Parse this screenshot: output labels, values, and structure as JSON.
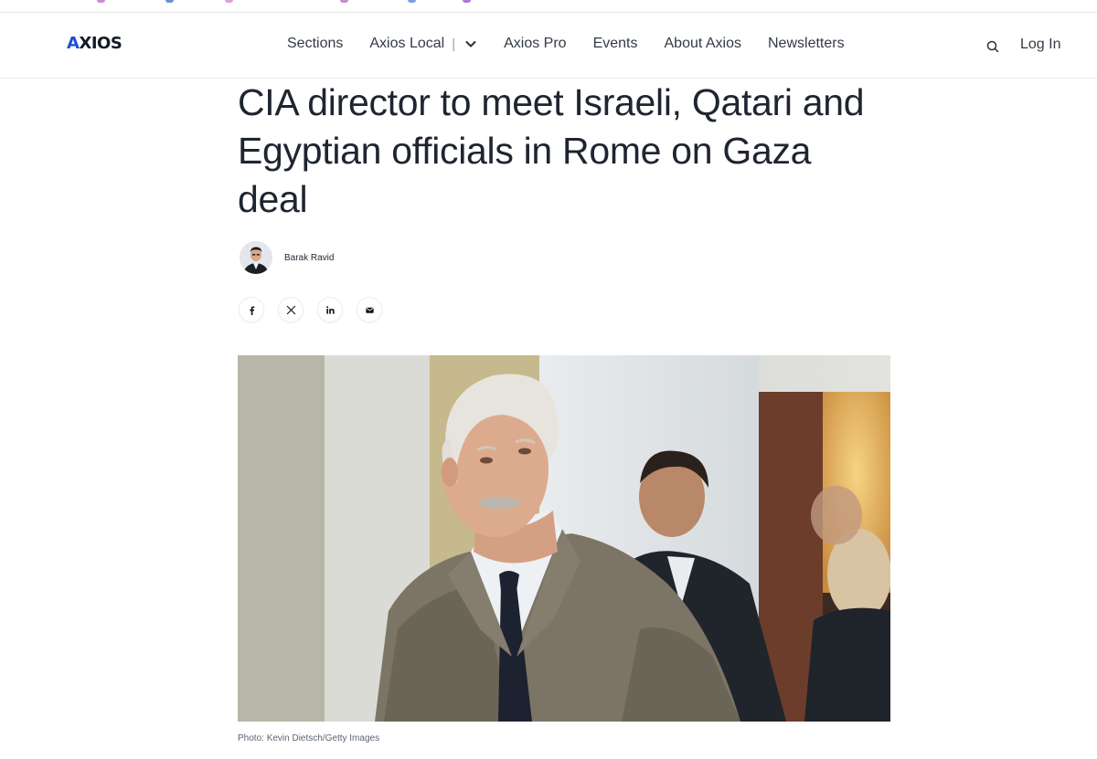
{
  "browser_bar": {
    "bookmark_dot_colors": [
      "#c98bd0",
      "#6c8fd6",
      "#d9a3d6",
      "#7c9ee0",
      "#a77ad8"
    ]
  },
  "header": {
    "logo": {
      "first": "A",
      "rest": "XIOS"
    },
    "nav": {
      "sections": "Sections",
      "local": "Axios Local",
      "local_separator": "|",
      "pro": "Axios Pro",
      "events": "Events",
      "about": "About Axios",
      "newsletters": "Newsletters"
    },
    "login": "Log In",
    "icons": {
      "search": "search-icon",
      "dropdown": "chevron-down-icon"
    }
  },
  "article": {
    "headline": "CIA director to meet Israeli, Qatari and Egyptian officials in Rome on Gaza deal",
    "author": "Barak Ravid",
    "share_icons": [
      "facebook-icon",
      "x-icon",
      "linkedin-icon",
      "email-icon"
    ],
    "photo_caption": "Photo: Kevin Dietsch/Getty Images"
  },
  "colors": {
    "logo_accent": "#1d4ed8",
    "headline": "#1f2530",
    "nav_text": "#333a45"
  }
}
